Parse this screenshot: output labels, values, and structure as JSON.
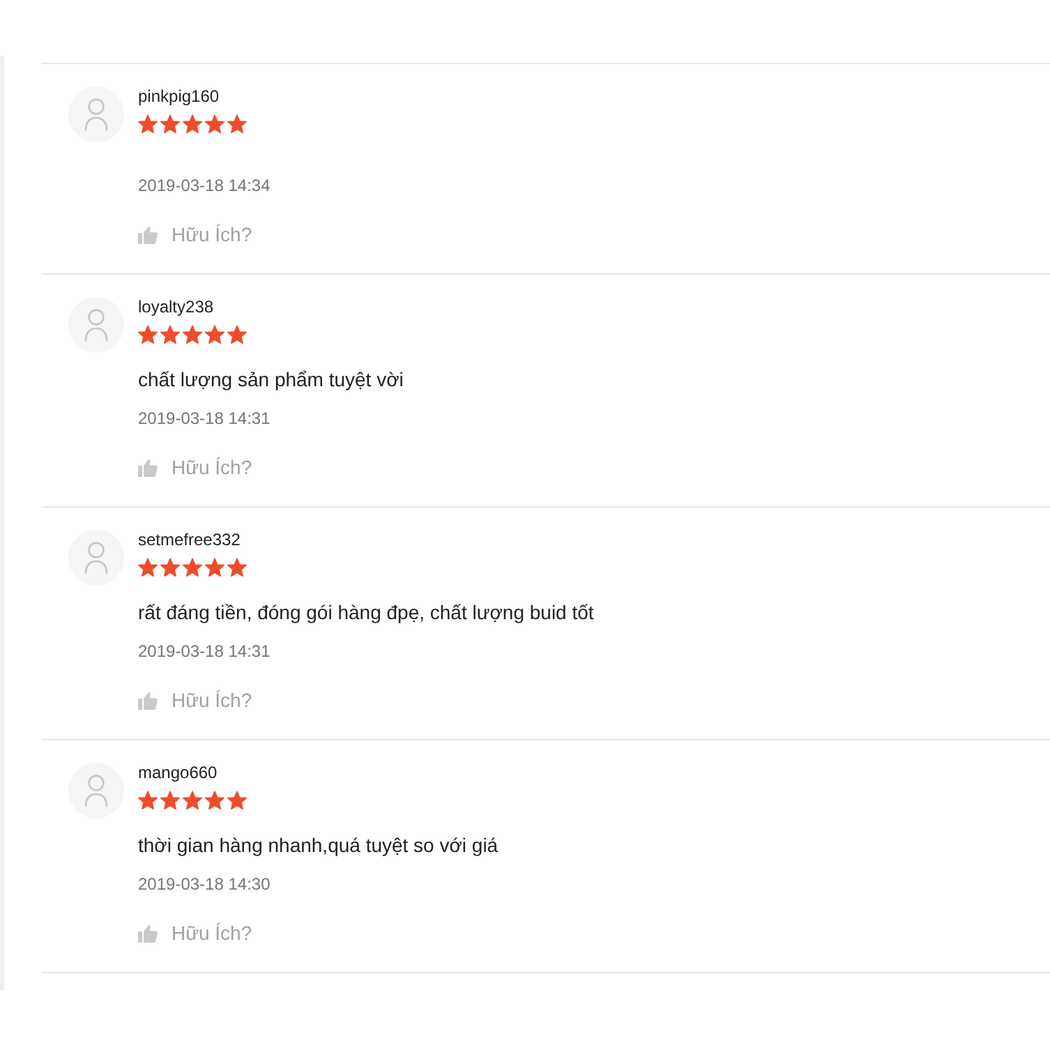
{
  "reviews": [
    {
      "username": "pinkpig160",
      "stars": 5,
      "date": "2019-03-18 14:34",
      "helpful_label": "Hữu Ích?"
    },
    {
      "username": "loyalty238",
      "stars": 5,
      "comment": "chất lượng sản phẩm tuyệt vời",
      "date": "2019-03-18 14:31",
      "helpful_label": "Hữu Ích?"
    },
    {
      "username": "setmefree332",
      "stars": 5,
      "comment": "rất đáng tiền, đóng gói hàng đpẹ, chất lượng buid tốt",
      "date": "2019-03-18 14:31",
      "helpful_label": "Hữu Ích?"
    },
    {
      "username": "mango660",
      "stars": 5,
      "comment": "thời gian hàng nhanh,quá tuyệt so với giá",
      "date": "2019-03-18 14:30",
      "helpful_label": "Hữu Ích?"
    }
  ]
}
